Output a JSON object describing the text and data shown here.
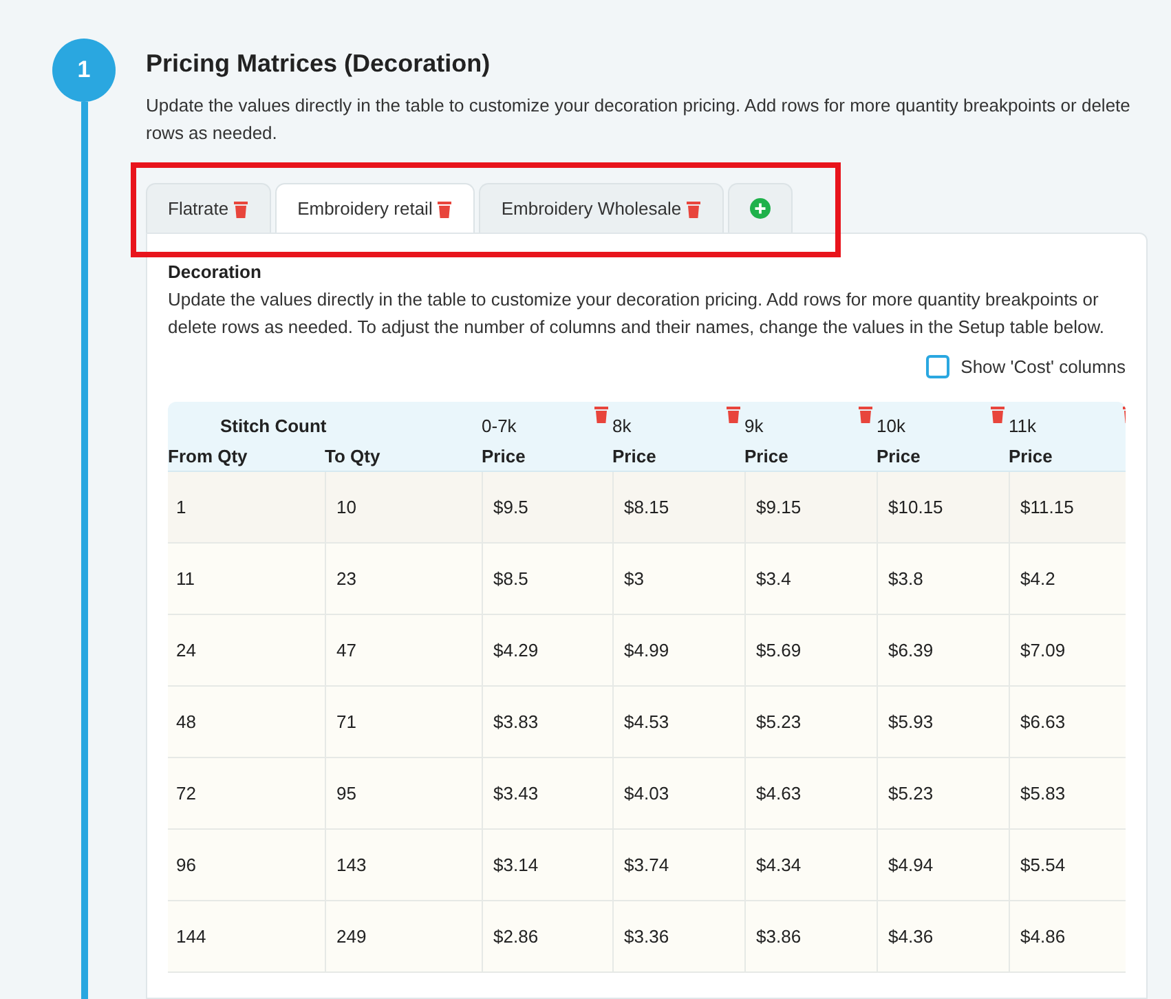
{
  "step": {
    "number": "1",
    "title": "Pricing Matrices (Decoration)",
    "description": "Update the values directly in the table to customize your decoration pricing. Add rows for more quantity breakpoints or delete rows as needed."
  },
  "tabs": [
    {
      "label": "Flatrate",
      "selected": false
    },
    {
      "label": "Embroidery retail",
      "selected": true
    },
    {
      "label": "Embroidery Wholesale",
      "selected": false
    }
  ],
  "highlight": {
    "color": "#e8141c"
  },
  "panel": {
    "title": "Decoration",
    "description": "Update the values directly in the table to customize your decoration pricing. Add rows for more quantity breakpoints or delete rows as needed. To adjust the number of columns and their names, change the values in the Setup table below.",
    "show_cost": {
      "label": "Show 'Cost' columns",
      "checked": false
    }
  },
  "table": {
    "group_header": "Stitch Count",
    "from_header": "From Qty",
    "to_header": "To Qty",
    "price_columns": [
      {
        "label": "0-7k",
        "sub": "Price"
      },
      {
        "label": "8k",
        "sub": "Price"
      },
      {
        "label": "9k",
        "sub": "Price"
      },
      {
        "label": "10k",
        "sub": "Price"
      },
      {
        "label": "11k",
        "sub": "Price"
      }
    ],
    "rows": [
      {
        "from": "1",
        "to": "10",
        "prices": [
          "$9.5",
          "$8.15",
          "$9.15",
          "$10.15",
          "$11.15"
        ]
      },
      {
        "from": "11",
        "to": "23",
        "prices": [
          "$8.5",
          "$3",
          "$3.4",
          "$3.8",
          "$4.2"
        ]
      },
      {
        "from": "24",
        "to": "47",
        "prices": [
          "$4.29",
          "$4.99",
          "$5.69",
          "$6.39",
          "$7.09"
        ]
      },
      {
        "from": "48",
        "to": "71",
        "prices": [
          "$3.83",
          "$4.53",
          "$5.23",
          "$5.93",
          "$6.63"
        ]
      },
      {
        "from": "72",
        "to": "95",
        "prices": [
          "$3.43",
          "$4.03",
          "$4.63",
          "$5.23",
          "$5.83"
        ]
      },
      {
        "from": "96",
        "to": "143",
        "prices": [
          "$3.14",
          "$3.74",
          "$4.34",
          "$4.94",
          "$5.54"
        ]
      },
      {
        "from": "144",
        "to": "249",
        "prices": [
          "$2.86",
          "$3.36",
          "$3.86",
          "$4.36",
          "$4.86"
        ]
      }
    ]
  }
}
